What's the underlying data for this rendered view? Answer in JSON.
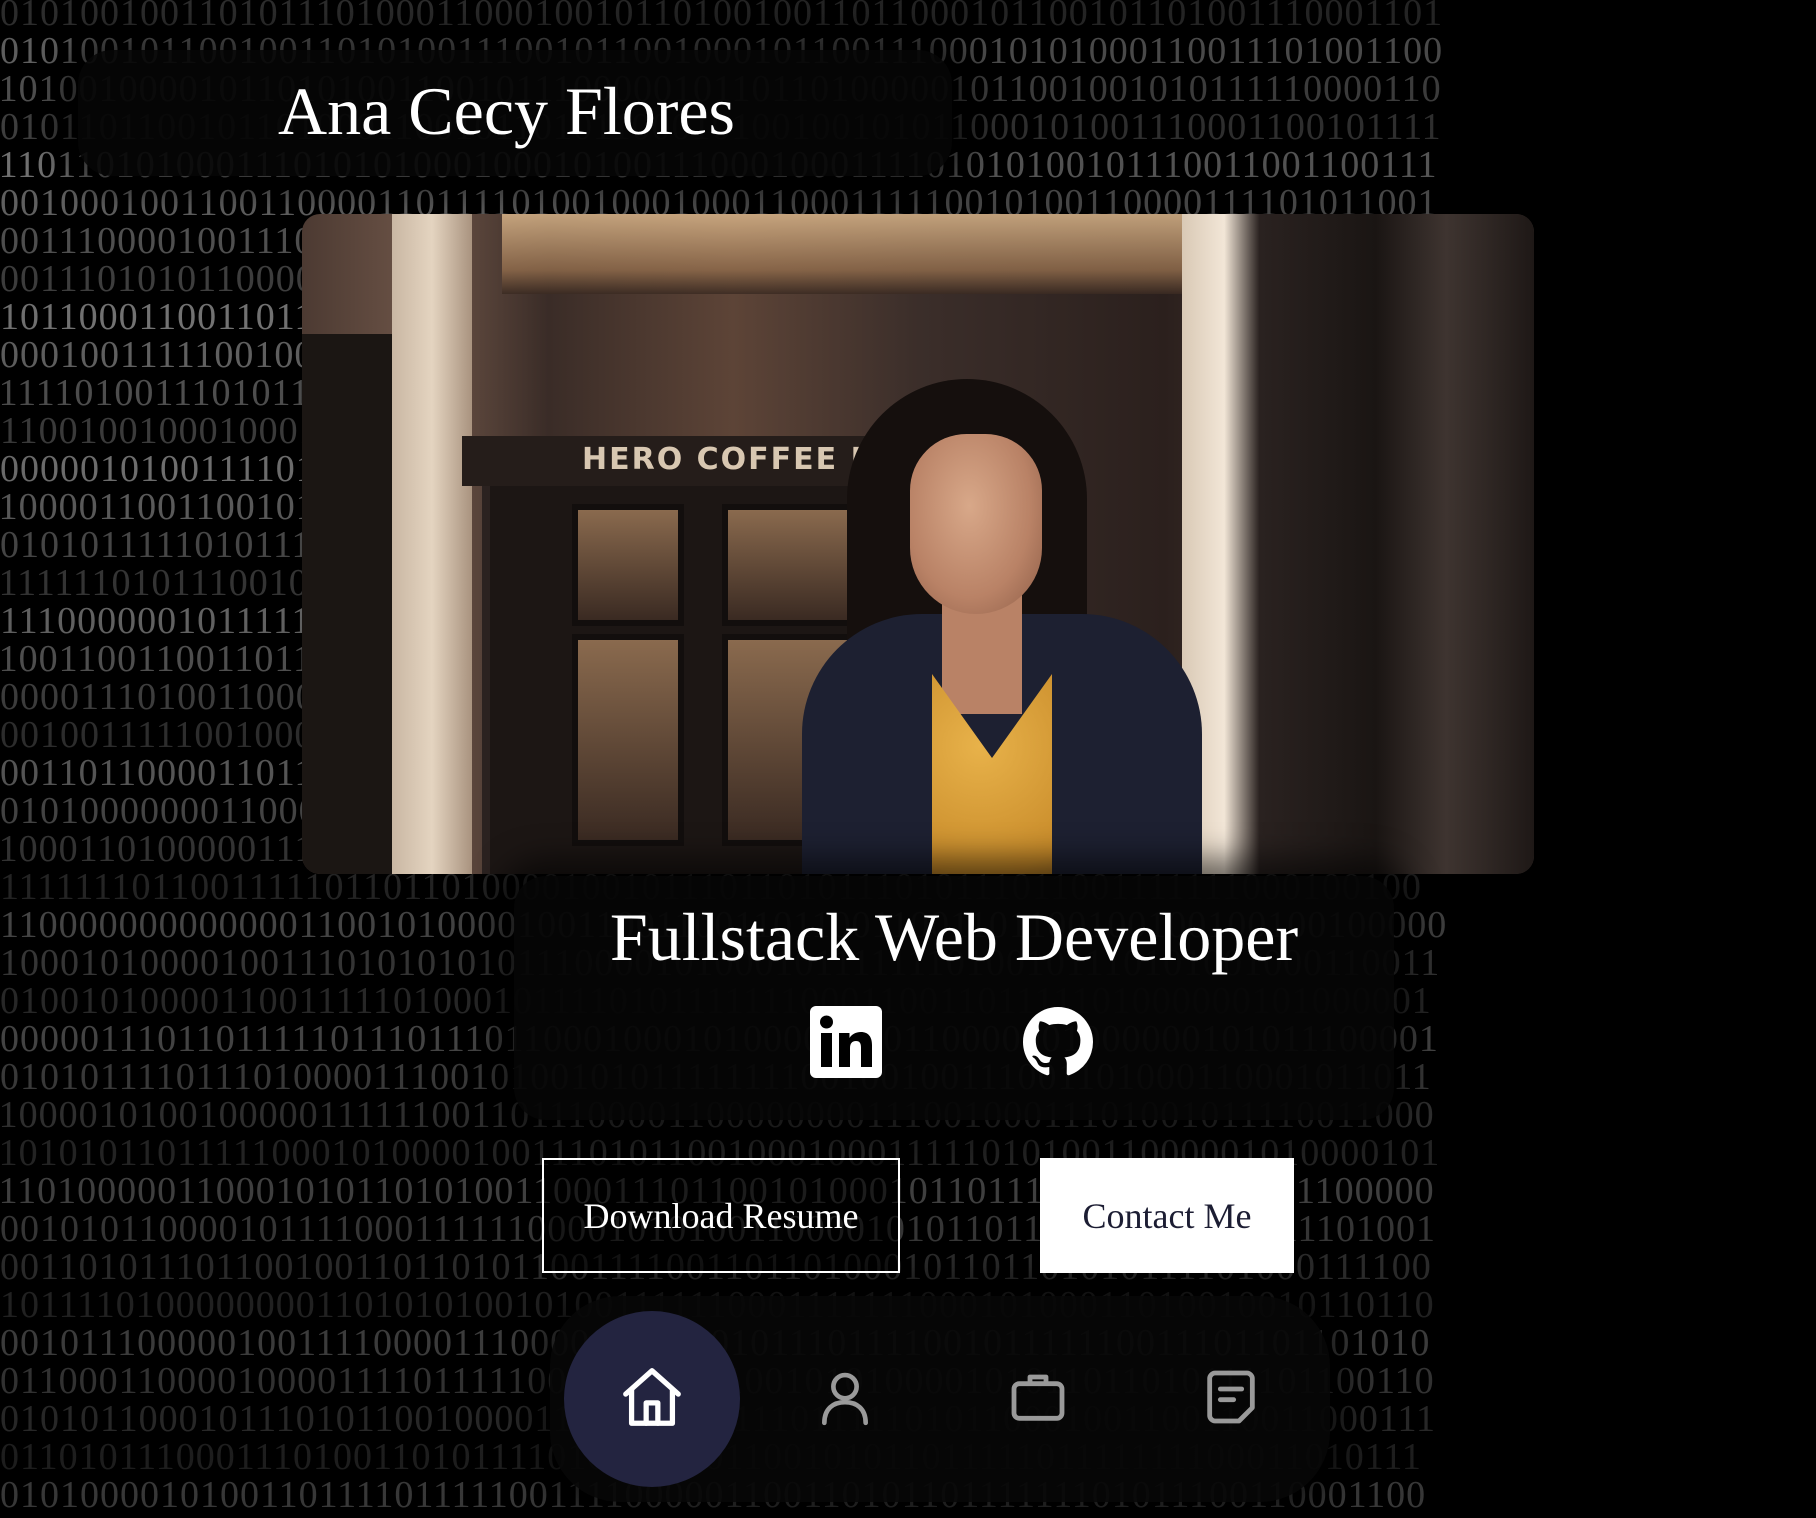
{
  "header": {
    "name": "Ana Cecy Flores"
  },
  "hero": {
    "photo_sign_text": "HERO COFFEE RO",
    "role": "Fullstack Web Developer"
  },
  "social": [
    {
      "icon": "linkedin-icon",
      "label": "LinkedIn"
    },
    {
      "icon": "github-icon",
      "label": "GitHub"
    }
  ],
  "buttons": {
    "download_resume": "Download Resume",
    "contact_me": "Contact Me"
  },
  "nav": {
    "items": [
      {
        "icon": "home-icon",
        "active": true
      },
      {
        "icon": "user-icon",
        "active": false
      },
      {
        "icon": "briefcase-icon",
        "active": false
      },
      {
        "icon": "notes-icon",
        "active": false
      }
    ]
  },
  "background": {
    "lines": [
      "00101001001101011101000110001001011010010011011000101100101101001110001101",
      "10101001011001001101010011100101100100010110011100010101000110011101001100",
      "11010010000101101010011001011100000101101101000001011001001010111110000110",
      "00101101100101101000110010110101100010100100101011000101001110001100101111",
      "11101101010001110101010001000101001110001000111101010100101110011001100111",
      "10010001001100110000110111101001000100011000111110010100110000111101011001",
      "10011100001001110111010000111011000001101100011010001011010001000101110101",
      "00011101010110000101001101111010000111010110101010100011101110110001000010",
      "01011000110011011000011101100100001001101000010111111110100000101111011001",
      "10001001111100100100001110100000001011100111101000011011100100111110111110",
      "11111010011101011110000000100101000100010011000100111111110000011011000100",
      "01100100100010001101101001110000110001101010110101110111001110000110010001",
      "10000010100111101001100111111111101100111100001010001010010000110101001111",
      "11000011001100101110011100010110011110001110110000011110100100100100100111",
      "10101011111010111000100101110110001011111010011110000101000110111000010010",
      "11111110101110010111100101001110111100010101100011011001001111010101110101",
      "01110000001011111011100101000100000101111011110111011110101110100100000111",
      "11001100110011011110111111000000101110000110111100100110101100001110111111",
      "00000111010011000101010101111111011100000101001100010101011101010010011110",
      "10010011111001000111000111110010010010111010010001001011101100111111010111",
      "00011011000011011000011001000011110001111110001000001001000111011010011000",
      "00101000000011000100010011101110100011110110100010110101011000101001111111",
      "11000110100000111111111101001000110011010000011010010100010101010001001100",
      "01111111011001111101101101000010010111011010111010111011001111111000100100",
      "01100000000000001100101000010011001100110110011001101100100100100100100000",
      "01000101000010011101010101011100001010001011111110100101110101001000110011",
      "10100101000011001111101000101111010111111100011001101111101000000101000001",
      "10000011101101111101110111011000100010100001000110000001000000101011100001",
      "10101011110111010000111001010010101111111100100100111001101000110001011011",
      "11000010100100000111111001101110000110000000011100100011101001011110011000",
      "11010101101111100010100001001110101100100010001111101010011000001010000101",
      "11101000001100010101101010011000111011001010001011011111000111110001100000",
      "10010101100001011110001111110000101010011000010101101101011100011011101001",
      "10011010111011001001101101011001111001101101000101101101010111101000111100",
      "01011110100000000110101010010100111111000111111100010100011010010010110110",
      "10010111000001001111000011100001000000101110111100101111110011101101101010",
      "00110001100001000011110111110011000110100101010000101011011010111101100110",
      "00101011000101110101100100001100100000111011111010110001001100110011000111",
      "10110101110001110100110101111010011100110010101101111101111111100011010111",
      "00101000010100110111101111100111100000110011010110111111101011100110001100"
    ]
  }
}
